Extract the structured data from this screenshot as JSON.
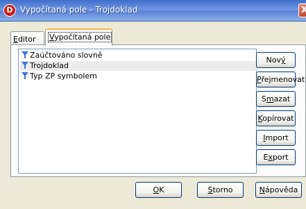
{
  "window": {
    "title": "Vypočítaná pole - Trojdoklad",
    "icon": "app-logo-icon",
    "icon_letter": "D",
    "close_glyph": "X"
  },
  "tabs": [
    {
      "label": "Editor",
      "mnemonic": "E",
      "rest": "ditor",
      "active": false
    },
    {
      "label": "Vypočítaná pole",
      "mnemonic": "V",
      "rest": "ypočítaná pole",
      "active": true
    }
  ],
  "list": {
    "items": [
      {
        "label": "Zaúčtováno slovně",
        "icon": "filter-icon",
        "selected": false
      },
      {
        "label": "Trojdoklad",
        "icon": "filter-icon",
        "selected": true
      },
      {
        "label": "Typ ZP symbolem",
        "icon": "filter-icon",
        "selected": false
      }
    ]
  },
  "side_buttons": [
    {
      "label": "Nový",
      "pre": "Nov",
      "mnemonic": "ý",
      "post": ""
    },
    {
      "label": "Přejmenovat",
      "pre": "",
      "mnemonic": "P",
      "post": "řejmenovat"
    },
    {
      "label": "Smazat",
      "pre": "S",
      "mnemonic": "m",
      "post": "azat"
    },
    {
      "label": "Kopírovat",
      "pre": "",
      "mnemonic": "K",
      "post": "opírovat"
    },
    {
      "label": "Import",
      "pre": "",
      "mnemonic": "I",
      "post": "mport"
    },
    {
      "label": "Export",
      "pre": "E",
      "mnemonic": "x",
      "post": "port"
    }
  ],
  "bottom_buttons": [
    {
      "label": "OK",
      "pre": "",
      "mnemonic": "O",
      "post": "K"
    },
    {
      "label": "Storno",
      "pre": "",
      "mnemonic": "S",
      "post": "torno"
    },
    {
      "label": "Nápověda",
      "pre": "",
      "mnemonic": "N",
      "post": "ápověda"
    }
  ],
  "colors": {
    "titlebar": "#5a84d6",
    "dialog_bg": "#ece9d8",
    "filter_icon": "#3f6fd6",
    "active_tab_accent": "#f7b94a"
  }
}
